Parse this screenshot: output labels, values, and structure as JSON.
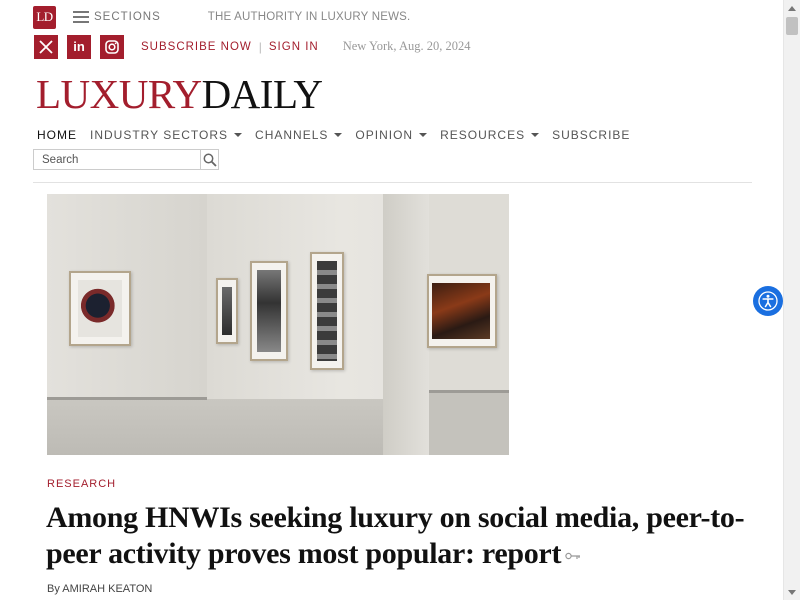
{
  "header": {
    "logo_text": "LD",
    "sections_label": "SECTIONS",
    "tagline": "THE AUTHORITY IN LUXURY NEWS.",
    "social": [
      {
        "icon": "x-icon",
        "glyph": "X"
      },
      {
        "icon": "linkedin-icon",
        "glyph": "in"
      },
      {
        "icon": "instagram-icon",
        "glyph": ""
      }
    ],
    "subscribe_label": "SUBSCRIBE NOW",
    "separator": "|",
    "signin_label": "SIGN IN",
    "dateline": "New York, Aug. 20, 2024",
    "brand_part1": "LUXURY",
    "brand_part2": "DAILY"
  },
  "nav": {
    "items": [
      {
        "label": "HOME",
        "dropdown": false
      },
      {
        "label": "INDUSTRY SECTORS",
        "dropdown": true
      },
      {
        "label": "CHANNELS",
        "dropdown": true
      },
      {
        "label": "OPINION",
        "dropdown": true
      },
      {
        "label": "RESOURCES",
        "dropdown": true
      },
      {
        "label": "SUBSCRIBE",
        "dropdown": false
      }
    ]
  },
  "search": {
    "placeholder": "Search"
  },
  "article": {
    "category": "RESEARCH",
    "headline": "Among HNWIs seeking luxury on social media, peer-to-peer activity proves most popular: report",
    "byline": "By AMIRAH KEATON"
  },
  "colors": {
    "brand_red": "#a31e2d",
    "accessibility_blue": "#1a6fe0"
  }
}
